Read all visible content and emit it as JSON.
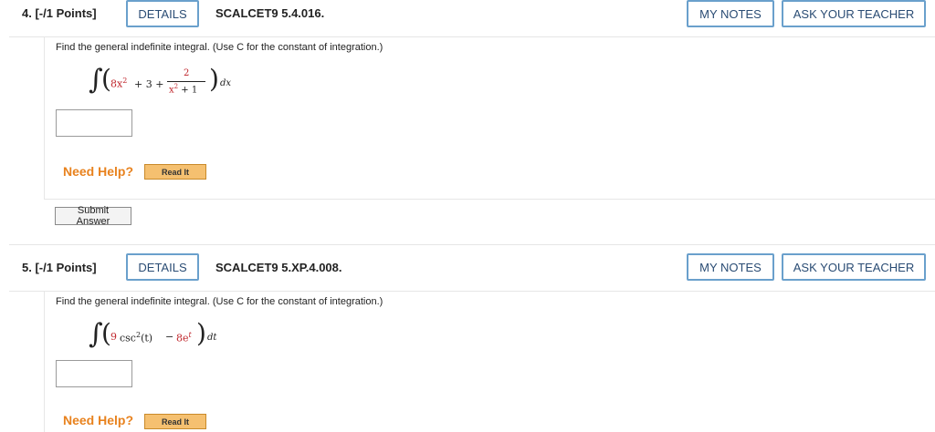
{
  "questions": [
    {
      "number_label": "4. [-/1 Points]",
      "details_label": "DETAILS",
      "code": "SCALCET9 5.4.016.",
      "my_notes_label": "MY NOTES",
      "ask_teacher_label": "ASK YOUR TEACHER",
      "prompt": "Find the general indefinite integral. (Use C for the constant of integration.)",
      "expression": {
        "integral": "∫",
        "term1": "8x",
        "exp1": "2",
        "plus1": "+ 3 +",
        "frac_num": "2",
        "frac_den_base": "x",
        "frac_den_exp": "2",
        "frac_den_tail": "+ 1",
        "differential": "dx"
      },
      "answer_value": "",
      "need_help_label": "Need Help?",
      "read_it_label": "Read It",
      "submit_label": "Submit Answer"
    },
    {
      "number_label": "5. [-/1 Points]",
      "details_label": "DETAILS",
      "code": "SCALCET9 5.XP.4.008.",
      "my_notes_label": "MY NOTES",
      "ask_teacher_label": "ASK YOUR TEACHER",
      "prompt": "Find the general indefinite integral. (Use C for the constant of integration.)",
      "expression": {
        "integral": "∫",
        "coef1": "9",
        "func1": "csc",
        "exp1": "2",
        "arg1": "(t)",
        "minus": "−",
        "coef2": "8e",
        "exp2": "t",
        "differential": "dt"
      },
      "answer_value": "",
      "need_help_label": "Need Help?",
      "read_it_label": "Read It"
    }
  ],
  "colors": {
    "accent_border": "#6aa0cc",
    "accent_text": "#2a4c74",
    "help_orange": "#e8821e",
    "readit_bg": "#f5c070",
    "expression_red": "#c0272d"
  }
}
